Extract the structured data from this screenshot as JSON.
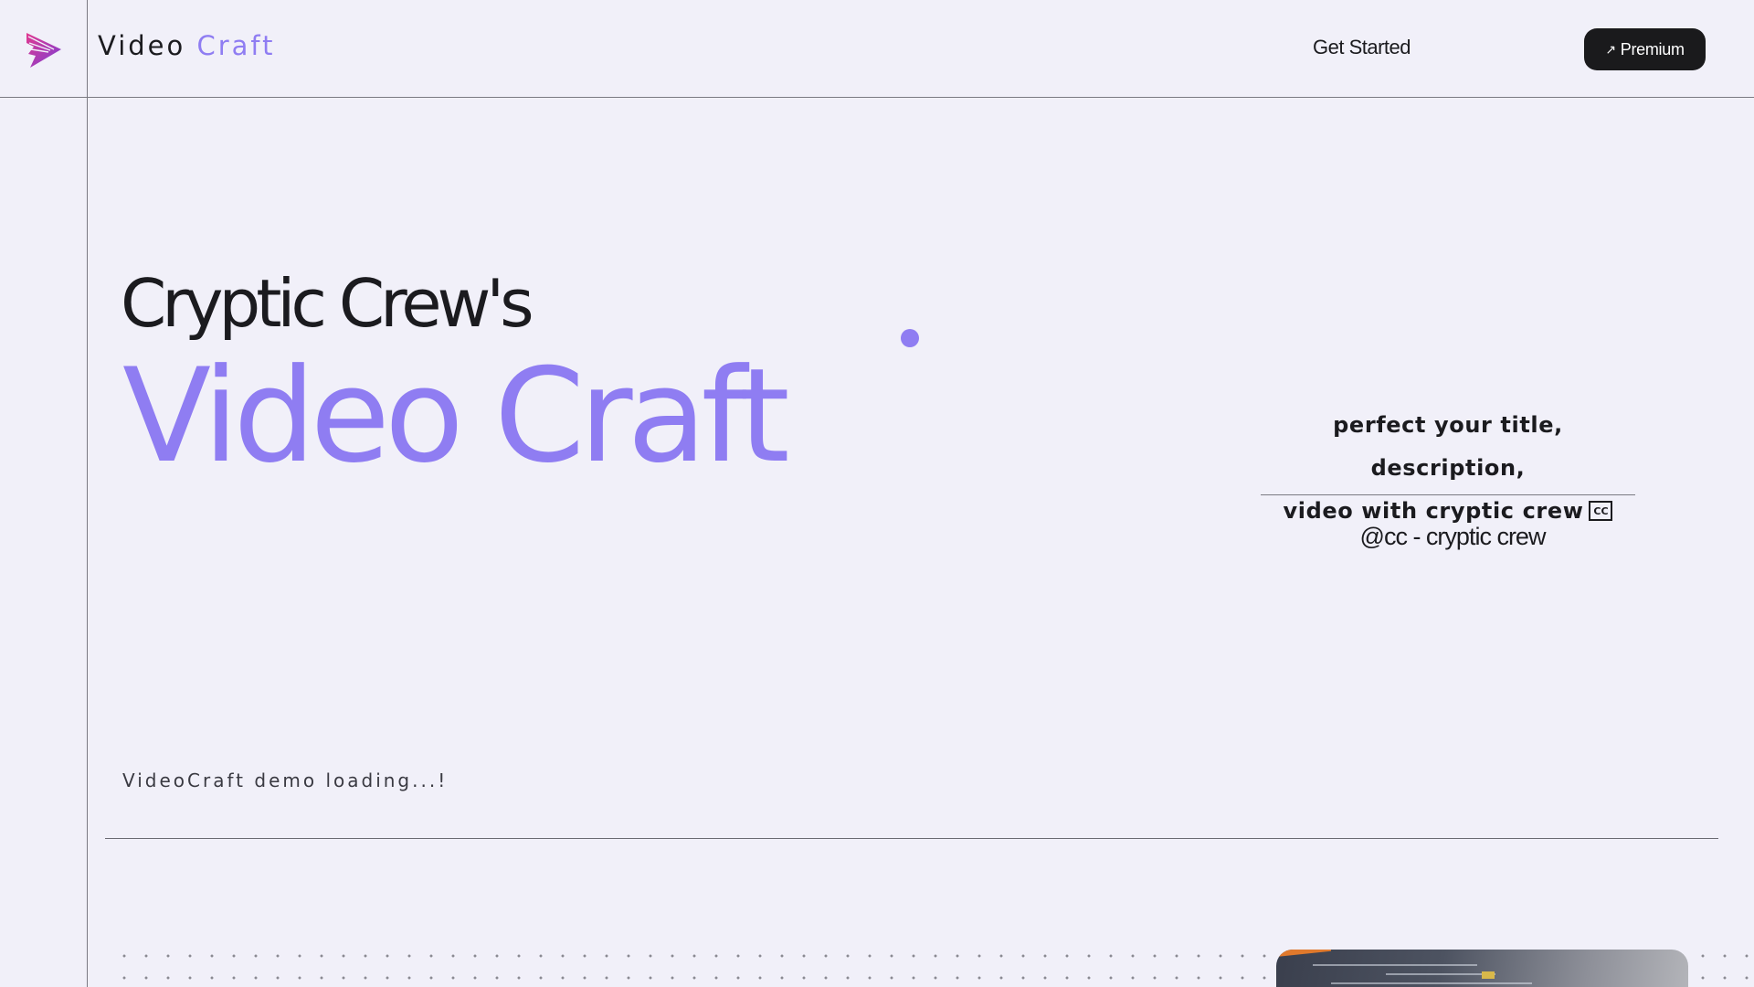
{
  "header": {
    "brand_word1": "Video",
    "brand_word2": "Craft",
    "get_started": "Get Started",
    "premium_arrow": "↗",
    "premium_label": "Premium"
  },
  "hero": {
    "line1": "Cryptic Crew's",
    "line2": "Video Craft"
  },
  "card": {
    "tagline_line1": "perfect your title, description,",
    "tagline_line2": "video with cryptic crew",
    "cc_icon_label": "CC",
    "handle": "@cc - cryptic crew"
  },
  "status": {
    "loading": "VideoCraft demo loading...!"
  },
  "colors": {
    "accent": "#8f7df2",
    "background": "#f1f0f9",
    "dark": "#1a1a1c"
  },
  "icons": {
    "logo": "play-wing-logo-icon",
    "cc": "closed-caption-icon",
    "arrow": "arrow-up-right-icon"
  }
}
